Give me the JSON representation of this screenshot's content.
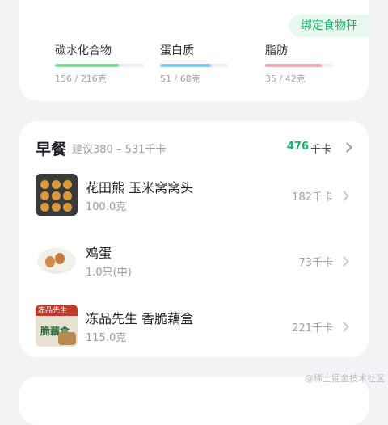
{
  "top": {
    "bind_button": "绑定食物秤",
    "macros": [
      {
        "name": "碳水化合物",
        "value": "156 / 216克",
        "fraction": 0.72,
        "color": "#7fdd9a"
      },
      {
        "name": "蛋白质",
        "value": "51 / 68克",
        "fraction": 0.75,
        "color": "#7fd3ef"
      },
      {
        "name": "脂肪",
        "value": "35 / 42克",
        "fraction": 0.83,
        "color": "#f4a9b6"
      }
    ]
  },
  "meal": {
    "title": "早餐",
    "hint": "建议380 – 531千卡",
    "kcal": "476",
    "kcal_unit": "千卡",
    "items": [
      {
        "name": "花田熊 玉米窝窝头",
        "amount": "100.0克",
        "kcal": "182千卡",
        "icon": "cornbread-tray-photo"
      },
      {
        "name": "鸡蛋",
        "amount": "1.0只(中)",
        "kcal": "73千卡",
        "icon": "boiled-eggs-photo"
      },
      {
        "name": "冻品先生 香脆藕盒",
        "amount": "115.0克",
        "kcal": "221千卡",
        "icon": "lotus-box-package-photo"
      }
    ]
  },
  "thumb_text": {
    "box_brand": "冻品先生",
    "box_label": "脆藕盒"
  },
  "watermark": "@稀土掘金技术社区"
}
